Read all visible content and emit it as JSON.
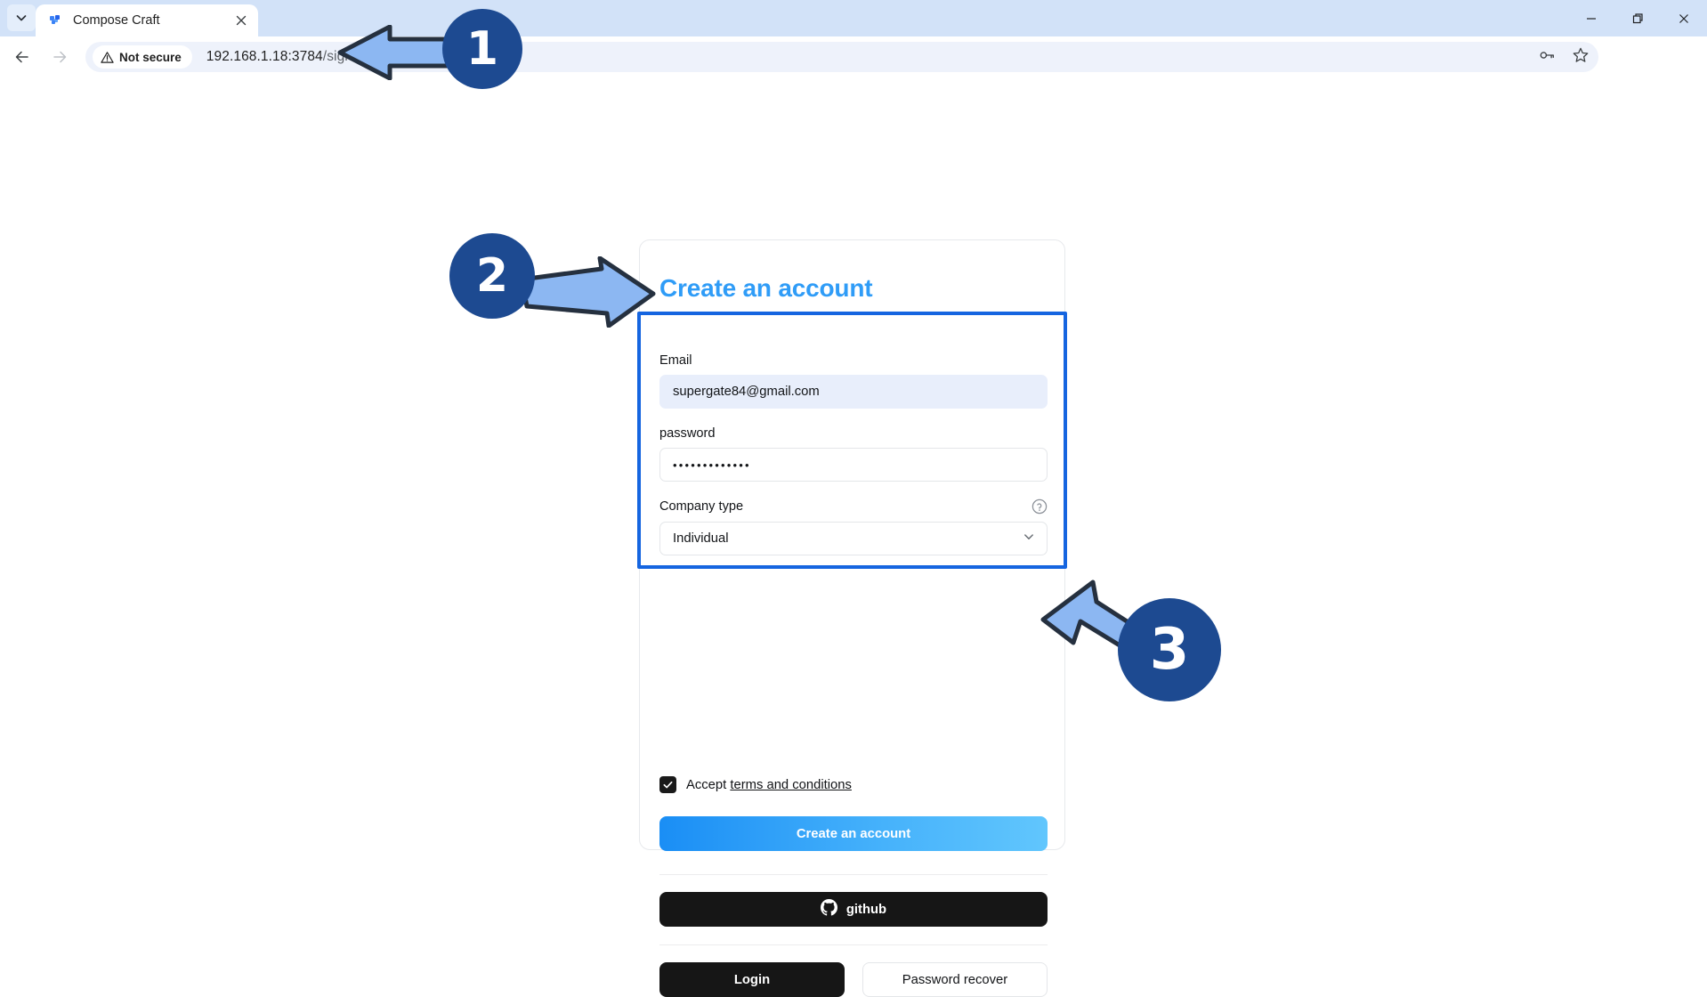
{
  "browser": {
    "tab": {
      "title": "Compose Craft",
      "favicon_icon": "compose-craft-favicon",
      "close_icon": "close-icon"
    },
    "tab_list_icon": "chevron-down-icon",
    "nav": {
      "back_icon": "back-arrow-icon",
      "forward_icon": "forward-arrow-icon",
      "reload_icon": "reload-icon"
    },
    "omnibox": {
      "security_icon": "warning-triangle-icon",
      "security_label": "Not secure",
      "url": "192.168.1.18:3784/signin",
      "url_host": "192.168.1.18:3784",
      "url_path": "/signin",
      "password_icon": "password-key-icon",
      "bookmark_icon": "star-icon"
    },
    "profile_icon": "profile-avatar-icon",
    "menu_icon": "kebab-menu-icon",
    "window_controls": {
      "minimize": "—",
      "maximize": "❐",
      "close": "✕"
    }
  },
  "page": {
    "card": {
      "title": "Create an account",
      "title_color": "#2f9cf7",
      "fields": [
        {
          "label": "Email",
          "value": "supergate84@gmail.com",
          "type": "email",
          "autofilled": true
        },
        {
          "label": "password",
          "value": "•••••••••••••",
          "type": "password",
          "autofilled": false
        }
      ],
      "company": {
        "label": "Company type",
        "help_icon": "question-circle-icon",
        "selected": "Individual",
        "chevron_icon": "chevron-down-icon"
      },
      "terms": {
        "checked": true,
        "check_icon": "checkmark-icon",
        "prefix": "Accept",
        "link": "terms and conditions"
      },
      "primary_button": {
        "label": "Create an account",
        "gradient_from": "#1a8ef5",
        "gradient_to": "#61c6fd"
      },
      "github_button": {
        "label": "github",
        "icon": "github-icon",
        "bg": "#161616"
      },
      "login_button": {
        "label": "Login",
        "bg": "#161616"
      },
      "recover_button": {
        "label": "Password recover",
        "bg": "#ffffff"
      }
    }
  },
  "annotations": {
    "badge_color": "#1d4a91",
    "arrow_fill": "#8cb7f2",
    "arrow_stroke": "#25303f",
    "highlight_color": "#1565e0",
    "steps": [
      {
        "number": "1",
        "points_at": "address-bar"
      },
      {
        "number": "2",
        "points_at": "signup-form-fields"
      },
      {
        "number": "3",
        "points_at": "create-account-button"
      }
    ]
  }
}
